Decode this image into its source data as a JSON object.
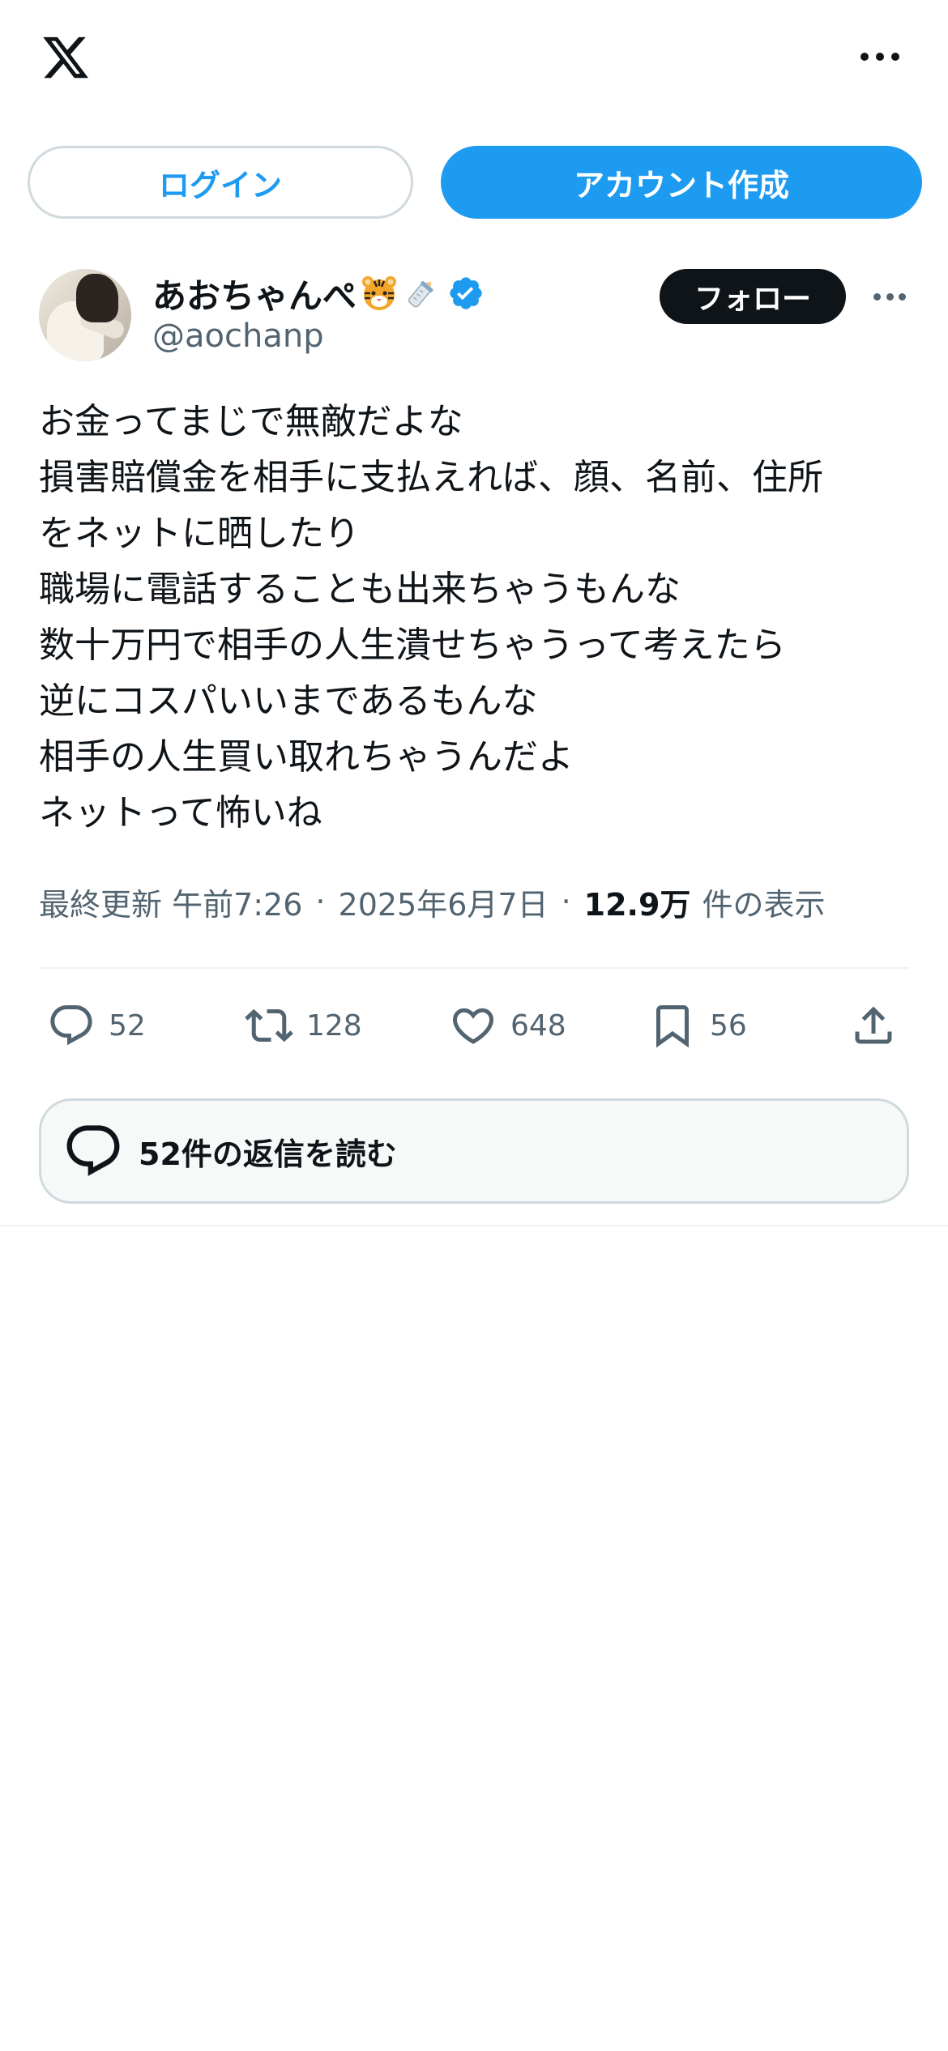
{
  "header": {
    "logo_icon": "x-logo-icon",
    "more_icon": "more-dots-icon"
  },
  "auth": {
    "login_label": "ログイン",
    "signup_label": "アカウント作成"
  },
  "author": {
    "display_name": "あおちゃんぺ",
    "emojis": [
      "tiger-face-emoji",
      "baby-bottle-emoji"
    ],
    "verified_icon": "verified-badge-icon",
    "handle": "@aochanp",
    "follow_label": "フォロー"
  },
  "tweet": {
    "lines": [
      "お金ってまじで無敵だよな",
      "損害賠償金を相手に支払えれば、顔、名前、住所",
      "をネットに晒したり",
      "職場に電話することも出来ちゃうもんな",
      "数十万円で相手の人生潰せちゃうって考えたら",
      "逆にコスパいいまであるもんな",
      "相手の人生買い取れちゃうんだよ",
      "ネットって怖いね"
    ],
    "meta": {
      "updated_label": "最終更新 午前7:26",
      "separator": "·",
      "date": "2025年6月7日",
      "views_count": "12.9万",
      "views_label": "件の表示"
    }
  },
  "actions": {
    "replies": "52",
    "retweets": "128",
    "likes": "648",
    "bookmarks": "56"
  },
  "read_replies": {
    "label": "52件の返信を読む"
  },
  "colors": {
    "accent": "#1d9bf0",
    "text": "#0f1419",
    "secondary": "#536471",
    "border": "#cfd9de"
  }
}
